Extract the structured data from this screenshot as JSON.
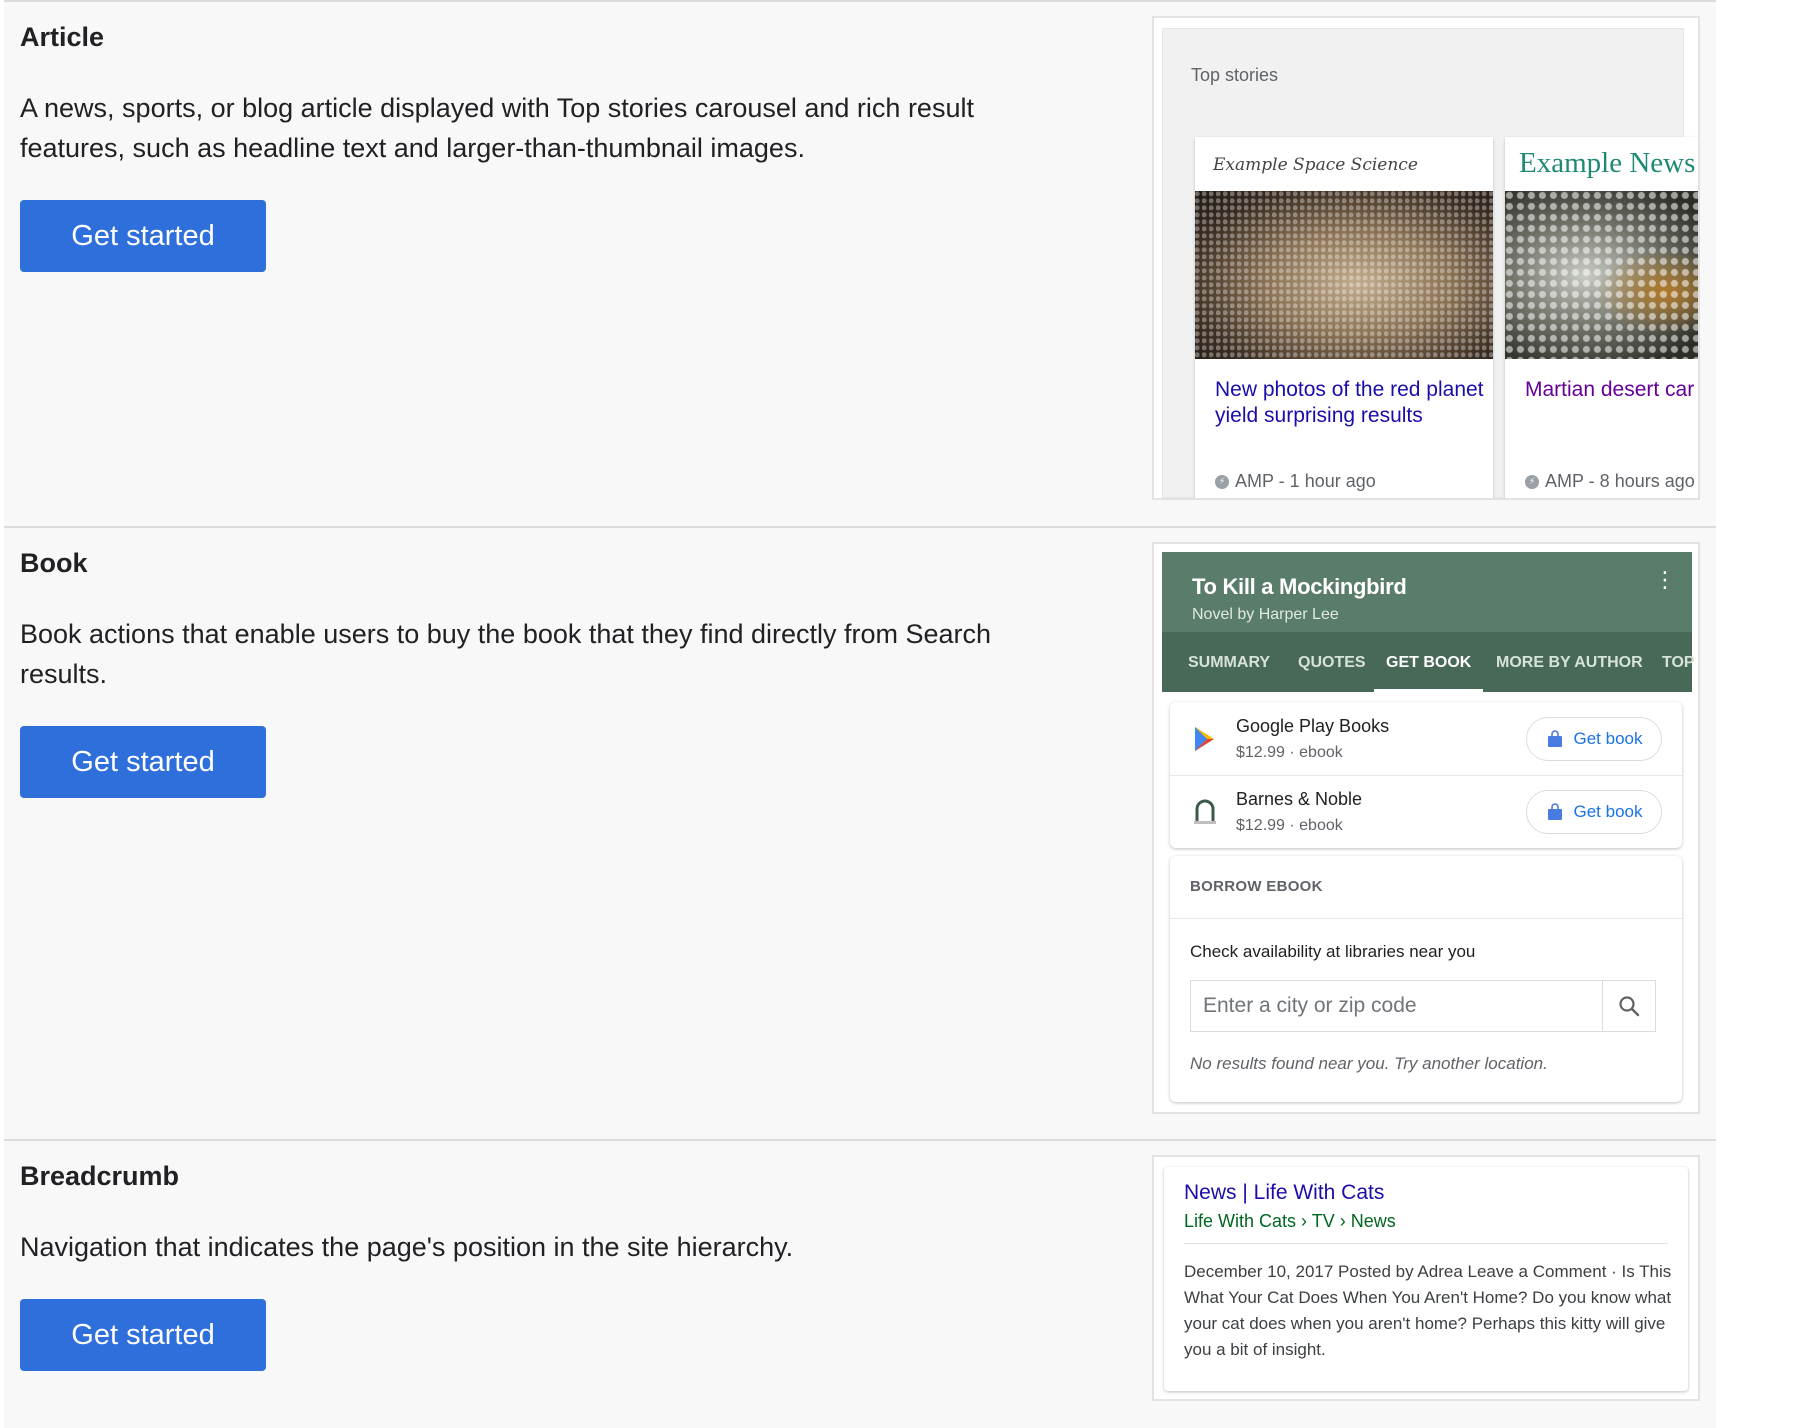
{
  "article": {
    "title": "Article",
    "description": "A news, sports, or blog article displayed with Top stories carousel and rich result features, such as headline text and larger-than-thumbnail images.",
    "button_label": "Get started",
    "preview": {
      "label": "Top stories",
      "stories": [
        {
          "publisher": "Example Space Science",
          "headline": "New photos of the red planet yield surprising results",
          "meta": "AMP - 1 hour ago"
        },
        {
          "publisher": "Example News",
          "headline": "Martian desert car food for explorers",
          "meta": "AMP - 8 hours ago"
        }
      ]
    }
  },
  "book": {
    "title": "Book",
    "description": "Book actions that enable users to buy the book that they find directly from Search results.",
    "button_label": "Get started",
    "preview": {
      "book_title": "To Kill a Mockingbird",
      "book_subtitle": "Novel by Harper Lee",
      "tabs": [
        "SUMMARY",
        "QUOTES",
        "GET BOOK",
        "MORE BY AUTHOR",
        "TOP"
      ],
      "active_tab": "GET BOOK",
      "retailers": [
        {
          "name": "Google Play Books",
          "price": "$12.99 · ebook",
          "button": "Get book"
        },
        {
          "name": "Barnes & Noble",
          "price": "$12.99 · ebook",
          "button": "Get book"
        }
      ],
      "borrow": {
        "title": "BORROW EBOOK",
        "check_text": "Check availability at libraries near you",
        "placeholder": "Enter a city or zip code",
        "no_results": "No results found near you. Try another location."
      }
    }
  },
  "breadcrumb": {
    "title": "Breadcrumb",
    "description": "Navigation that indicates the page's position in the site hierarchy.",
    "button_label": "Get started",
    "preview": {
      "result_title": "News | Life With Cats",
      "path": "Life With Cats › TV › News",
      "snippet": "December 10, 2017 Posted by Adrea Leave a Comment · Is This What Your Cat Does When You Aren't Home? Do you know what your cat does when you aren't home? Perhaps this kitty will give you a bit of insight."
    }
  },
  "colors": {
    "button_blue": "#2f6fdc",
    "book_header_green": "#5a7d6b",
    "link_blue": "#1a0dab",
    "visited_purple": "#660099",
    "url_green": "#006621"
  },
  "icons": [
    "amp-icon",
    "kebab-menu-icon",
    "google-play-icon",
    "barnes-noble-icon",
    "shopping-bag-icon",
    "search-icon"
  ]
}
